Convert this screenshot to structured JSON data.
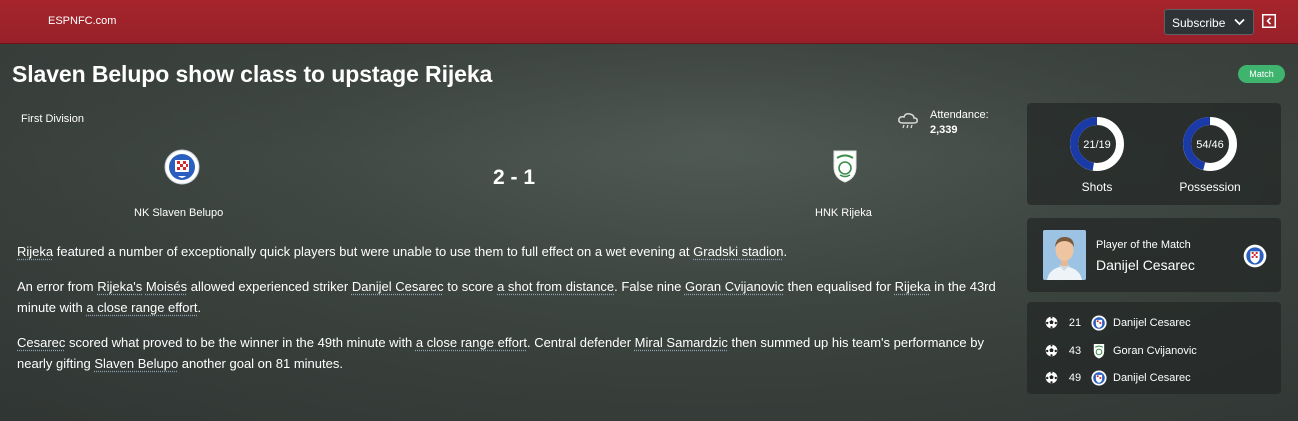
{
  "site": {
    "name": "ESPNFC.com"
  },
  "header": {
    "subscribe_label": "Subscribe"
  },
  "article": {
    "title": "Slaven Belupo show class to upstage Rijeka",
    "badge": "Match"
  },
  "match": {
    "competition": "First Division",
    "attendance_label": "Attendance:",
    "attendance_value": "2,339",
    "weather_icon": "rain-cloud-icon",
    "home_team": "NK Slaven Belupo",
    "away_team": "HNK Rijeka",
    "score": "2 - 1"
  },
  "report": [
    [
      {
        "t": "Rijeka",
        "link": true
      },
      {
        "t": " featured a number of exceptionally quick players but were unable to use them to full effect on a wet evening at "
      },
      {
        "t": "Gradski stadion",
        "link": true
      },
      {
        "t": "."
      }
    ],
    [
      {
        "t": "An error from "
      },
      {
        "t": "Rijeka's",
        "link": true
      },
      {
        "t": " "
      },
      {
        "t": "Moisés",
        "link": true
      },
      {
        "t": " allowed experienced striker "
      },
      {
        "t": "Danijel Cesarec",
        "link": true
      },
      {
        "t": " to score "
      },
      {
        "t": "a shot from distance",
        "link": true
      },
      {
        "t": ". False nine "
      },
      {
        "t": "Goran Cvijanovic",
        "link": true
      },
      {
        "t": " then equalised for "
      },
      {
        "t": "Rijeka",
        "link": true
      },
      {
        "t": " in the 43rd minute with "
      },
      {
        "t": "a close range effort",
        "link": true
      },
      {
        "t": "."
      }
    ],
    [
      {
        "t": "Cesarec",
        "link": true
      },
      {
        "t": " scored what proved to be the winner in the 49th minute with "
      },
      {
        "t": "a close range effort",
        "link": true
      },
      {
        "t": ". Central defender "
      },
      {
        "t": "Miral Samardzic",
        "link": true
      },
      {
        "t": " then summed up his team's performance by nearly gifting "
      },
      {
        "t": "Slaven Belupo",
        "link": true
      },
      {
        "t": " another goal on 81 minutes."
      }
    ]
  ],
  "stats": {
    "shots_label": "Shots",
    "shots_text": "21/19",
    "shots_home_share": 0.525,
    "possession_label": "Possession",
    "possession_text": "54/46",
    "possession_home_share": 0.54,
    "home_color": "#ffffff",
    "away_color": "#1a3aa8"
  },
  "potm": {
    "title": "Player of the Match",
    "name": "Danijel Cesarec"
  },
  "goals": [
    {
      "minute": "21",
      "team": "home",
      "scorer": "Danijel Cesarec"
    },
    {
      "minute": "43",
      "team": "away",
      "scorer": "Goran Cvijanovic"
    },
    {
      "minute": "49",
      "team": "home",
      "scorer": "Danijel Cesarec"
    }
  ],
  "colors": {
    "topbar": "#a6252b",
    "badge": "#3eb46f",
    "accent_blue": "#1a3aa8"
  }
}
